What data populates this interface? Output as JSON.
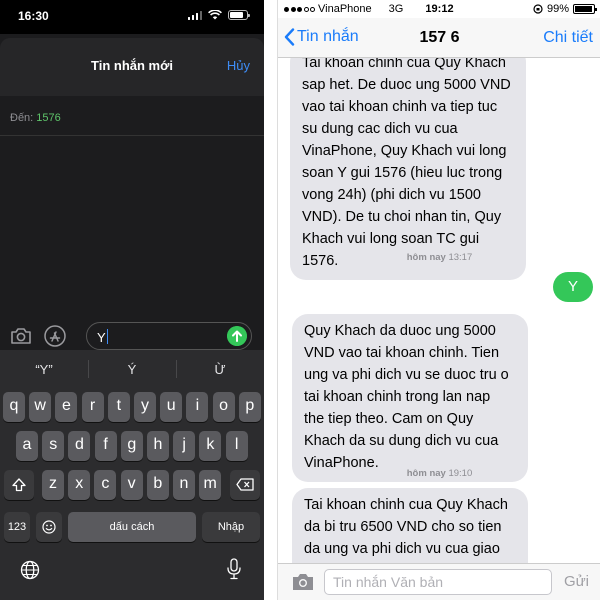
{
  "left": {
    "status": {
      "time": "16:30"
    },
    "header": {
      "title": "Tin nhắn mới",
      "cancel": "Hủy"
    },
    "to": {
      "label": "Đến:",
      "value": "1576"
    },
    "compose": {
      "text": "Y"
    },
    "keyboard": {
      "suggestions": [
        "“Y”",
        "Ý",
        "Ừ"
      ],
      "row1": [
        "q",
        "w",
        "e",
        "r",
        "t",
        "y",
        "u",
        "i",
        "o",
        "p"
      ],
      "row2": [
        "a",
        "s",
        "d",
        "f",
        "g",
        "h",
        "j",
        "k",
        "l"
      ],
      "row3": [
        "z",
        "x",
        "c",
        "v",
        "b",
        "n",
        "m"
      ],
      "shift_icon": "shift-icon",
      "delete_icon": "delete-icon",
      "numbers": "123",
      "emoji_icon": "emoji-icon",
      "space": "dấu cách",
      "return": "Nhập",
      "globe_icon": "globe-icon",
      "mic_icon": "mic-icon"
    }
  },
  "right": {
    "status": {
      "carrier": "VinaPhone",
      "network": "3G",
      "time": "19:12",
      "battery": "99%"
    },
    "nav": {
      "back": "Tin nhắn",
      "title": "157 6",
      "details": "Chi tiết"
    },
    "messages": [
      {
        "from": "them",
        "text": "Tai khoan chinh cua Quy Khach\nsap het. De duoc ung 5000 VND\nvao tai khoan chinh va tiep tuc\nsu dung cac dich vu cua\nVinaPhone, Quy Khach vui long\nsoan Y gui 1576 (hieu luc trong\nvong 24h) (phi dich  vu 1500\nVND). De tu choi nhan tin, Quy\nKhach vui long soan TC gui\n1576."
      },
      {
        "day": "hôm nay",
        "time": "13:17"
      },
      {
        "from": "me",
        "text": "Y"
      },
      {
        "from": "them",
        "text": "Quy Khach da duoc ung 5000\nVND vao tai khoan chinh. Tien\nung va phi dich vu se duoc tru o\ntai khoan chinh trong lan nap\nthe tiep theo. Cam on Quy\nKhach da su dung dich vu cua\nVinaPhone."
      },
      {
        "day": "hôm nay",
        "time": "19:10"
      },
      {
        "from": "them",
        "text": "Tai khoan chinh cua Quy Khach\nda bi tru 6500 VND cho so tien\nda ung va phi dich vu cua giao\ndich Ung tien nhanh. Xin tran"
      }
    ],
    "compose": {
      "placeholder": "Tin nhắn Văn bản",
      "send": "Gửi"
    }
  },
  "colors": {
    "ios_blue": "#1a7cfa",
    "imessage_green": "#34c759",
    "received_bubble": "#e5e5ea"
  }
}
